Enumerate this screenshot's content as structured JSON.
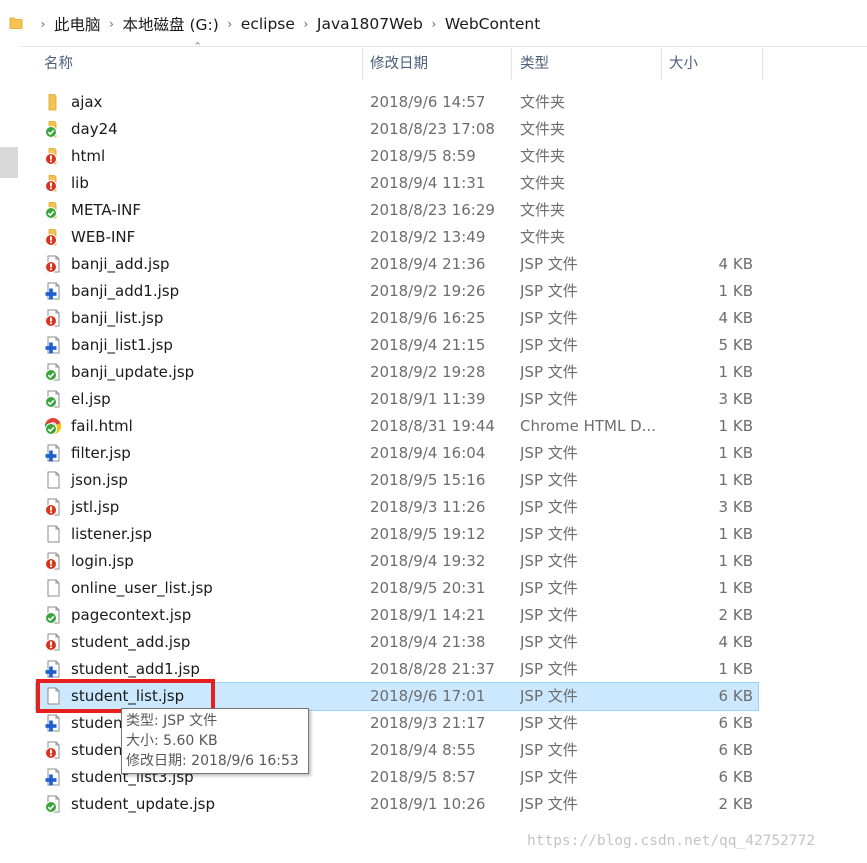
{
  "breadcrumb": [
    "此电脑",
    "本地磁盘 (G:)",
    "eclipse",
    "Java1807Web",
    "WebContent"
  ],
  "columns": {
    "name": "名称",
    "date": "修改日期",
    "type": "类型",
    "size": "大小"
  },
  "files": [
    {
      "icon": "folder",
      "overlay": "none",
      "name": "ajax",
      "date": "2018/9/6 14:57",
      "type": "文件夹",
      "size": ""
    },
    {
      "icon": "folder",
      "overlay": "green",
      "name": "day24",
      "date": "2018/8/23 17:08",
      "type": "文件夹",
      "size": ""
    },
    {
      "icon": "folder",
      "overlay": "red",
      "name": "html",
      "date": "2018/9/5 8:59",
      "type": "文件夹",
      "size": ""
    },
    {
      "icon": "folder",
      "overlay": "red",
      "name": "lib",
      "date": "2018/9/4 11:31",
      "type": "文件夹",
      "size": ""
    },
    {
      "icon": "folder",
      "overlay": "green",
      "name": "META-INF",
      "date": "2018/8/23 16:29",
      "type": "文件夹",
      "size": ""
    },
    {
      "icon": "folder",
      "overlay": "red",
      "name": "WEB-INF",
      "date": "2018/9/2 13:49",
      "type": "文件夹",
      "size": ""
    },
    {
      "icon": "file",
      "overlay": "red",
      "name": "banji_add.jsp",
      "date": "2018/9/4 21:36",
      "type": "JSP 文件",
      "size": "4 KB"
    },
    {
      "icon": "file",
      "overlay": "blue",
      "name": "banji_add1.jsp",
      "date": "2018/9/2 19:26",
      "type": "JSP 文件",
      "size": "1 KB"
    },
    {
      "icon": "file",
      "overlay": "red",
      "name": "banji_list.jsp",
      "date": "2018/9/6 16:25",
      "type": "JSP 文件",
      "size": "4 KB"
    },
    {
      "icon": "file",
      "overlay": "blue",
      "name": "banji_list1.jsp",
      "date": "2018/9/4 21:15",
      "type": "JSP 文件",
      "size": "5 KB"
    },
    {
      "icon": "file",
      "overlay": "green",
      "name": "banji_update.jsp",
      "date": "2018/9/2 19:28",
      "type": "JSP 文件",
      "size": "1 KB"
    },
    {
      "icon": "file",
      "overlay": "green",
      "name": "el.jsp",
      "date": "2018/9/1 11:39",
      "type": "JSP 文件",
      "size": "3 KB"
    },
    {
      "icon": "chrome",
      "overlay": "green",
      "name": "fail.html",
      "date": "2018/8/31 19:44",
      "type": "Chrome HTML D...",
      "size": "1 KB"
    },
    {
      "icon": "file",
      "overlay": "blue",
      "name": "filter.jsp",
      "date": "2018/9/4 16:04",
      "type": "JSP 文件",
      "size": "1 KB"
    },
    {
      "icon": "file",
      "overlay": "none",
      "name": "json.jsp",
      "date": "2018/9/5 15:16",
      "type": "JSP 文件",
      "size": "1 KB"
    },
    {
      "icon": "file",
      "overlay": "red",
      "name": "jstl.jsp",
      "date": "2018/9/3 11:26",
      "type": "JSP 文件",
      "size": "3 KB"
    },
    {
      "icon": "file",
      "overlay": "none",
      "name": "listener.jsp",
      "date": "2018/9/5 19:12",
      "type": "JSP 文件",
      "size": "1 KB"
    },
    {
      "icon": "file",
      "overlay": "red",
      "name": "login.jsp",
      "date": "2018/9/4 19:32",
      "type": "JSP 文件",
      "size": "1 KB"
    },
    {
      "icon": "file",
      "overlay": "none",
      "name": "online_user_list.jsp",
      "date": "2018/9/5 20:31",
      "type": "JSP 文件",
      "size": "1 KB"
    },
    {
      "icon": "file",
      "overlay": "green",
      "name": "pagecontext.jsp",
      "date": "2018/9/1 14:21",
      "type": "JSP 文件",
      "size": "2 KB"
    },
    {
      "icon": "file",
      "overlay": "red",
      "name": "student_add.jsp",
      "date": "2018/9/4 21:38",
      "type": "JSP 文件",
      "size": "4 KB"
    },
    {
      "icon": "file",
      "overlay": "blue",
      "name": "student_add1.jsp",
      "date": "2018/8/28 21:37",
      "type": "JSP 文件",
      "size": "1 KB"
    },
    {
      "icon": "file",
      "overlay": "none",
      "name": "student_list.jsp",
      "date": "2018/9/6 17:01",
      "type": "JSP 文件",
      "size": "6 KB",
      "selected": true
    },
    {
      "icon": "file",
      "overlay": "blue",
      "name": "studen",
      "date": "2018/9/3 21:17",
      "type": "JSP 文件",
      "size": "6 KB"
    },
    {
      "icon": "file",
      "overlay": "red",
      "name": "studen",
      "date": "2018/9/4 8:55",
      "type": "JSP 文件",
      "size": "6 KB"
    },
    {
      "icon": "file",
      "overlay": "blue",
      "name": "student_list3.jsp",
      "date": "2018/9/5 8:57",
      "type": "JSP 文件",
      "size": "6 KB"
    },
    {
      "icon": "file",
      "overlay": "green",
      "name": "student_update.jsp",
      "date": "2018/9/1 10:26",
      "type": "JSP 文件",
      "size": "2 KB"
    }
  ],
  "tooltip": {
    "type_line": "类型: JSP 文件",
    "size_line": "大小: 5.60 KB",
    "date_line": "修改日期: 2018/9/6 16:53"
  },
  "watermark": "https://blog.csdn.net/qq_42752772",
  "colors": {
    "selection": "#cce8ff",
    "highlight_box": "#e8201b",
    "overlay_red": "#d9341e",
    "overlay_green": "#3aa53a",
    "overlay_blue": "#1e5fd0",
    "folder": "#f3c44f"
  }
}
